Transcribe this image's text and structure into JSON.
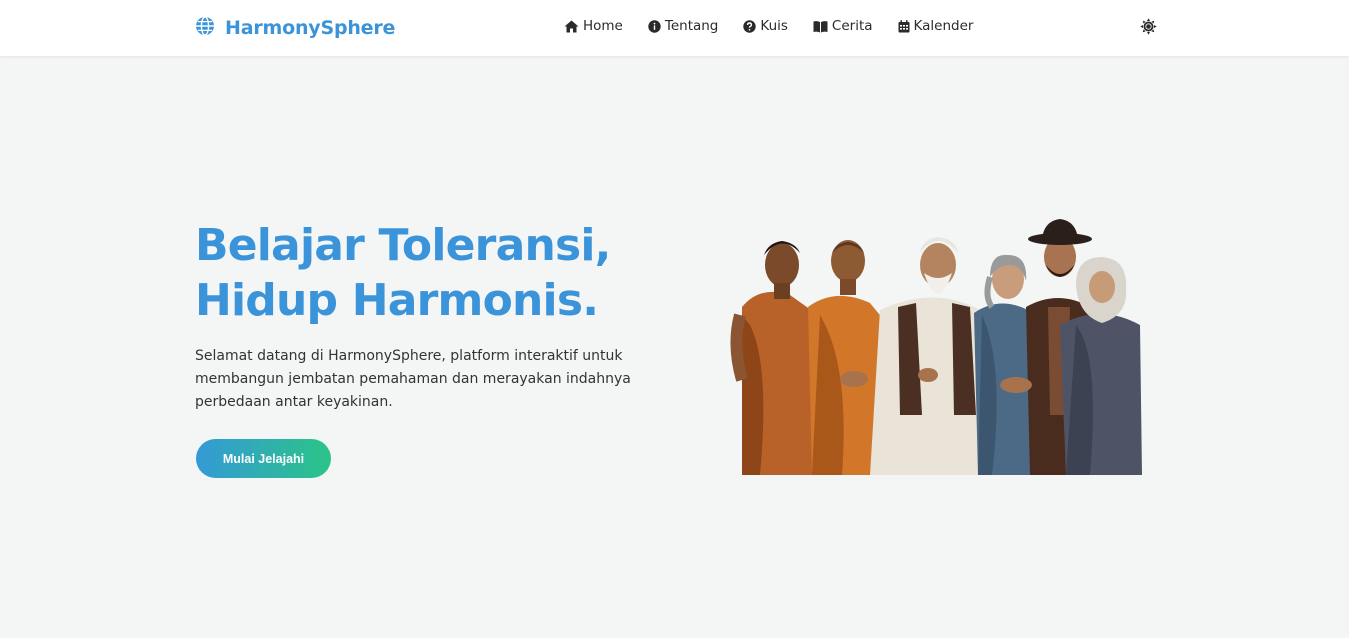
{
  "brand": {
    "name": "HarmonySphere",
    "icon": "globe-icon",
    "color": "#3b94d9"
  },
  "nav": {
    "items": [
      {
        "label": "Home",
        "icon": "home-icon"
      },
      {
        "label": "Tentang",
        "icon": "info-icon"
      },
      {
        "label": "Kuis",
        "icon": "question-icon"
      },
      {
        "label": "Cerita",
        "icon": "book-icon"
      },
      {
        "label": "Kalender",
        "icon": "calendar-icon"
      }
    ],
    "theme_toggle_icon": "sun-icon"
  },
  "hero": {
    "title_line1": "Belajar Toleransi,",
    "title_line2": "Hidup Harmonis.",
    "description": "Selamat datang di HarmonySphere, platform interaktif untuk membangun jembatan pemahaman dan merayakan indahnya perbedaan antar keyakinan.",
    "cta_label": "Mulai Jelajahi",
    "cta_gradient": [
      "#349ad6",
      "#2bc487"
    ]
  },
  "illustration": {
    "subject": "group-of-people-holding-hands"
  },
  "colors": {
    "accent": "#3b94d9",
    "background": "#f4f6f6",
    "navbar": "#ffffff"
  }
}
